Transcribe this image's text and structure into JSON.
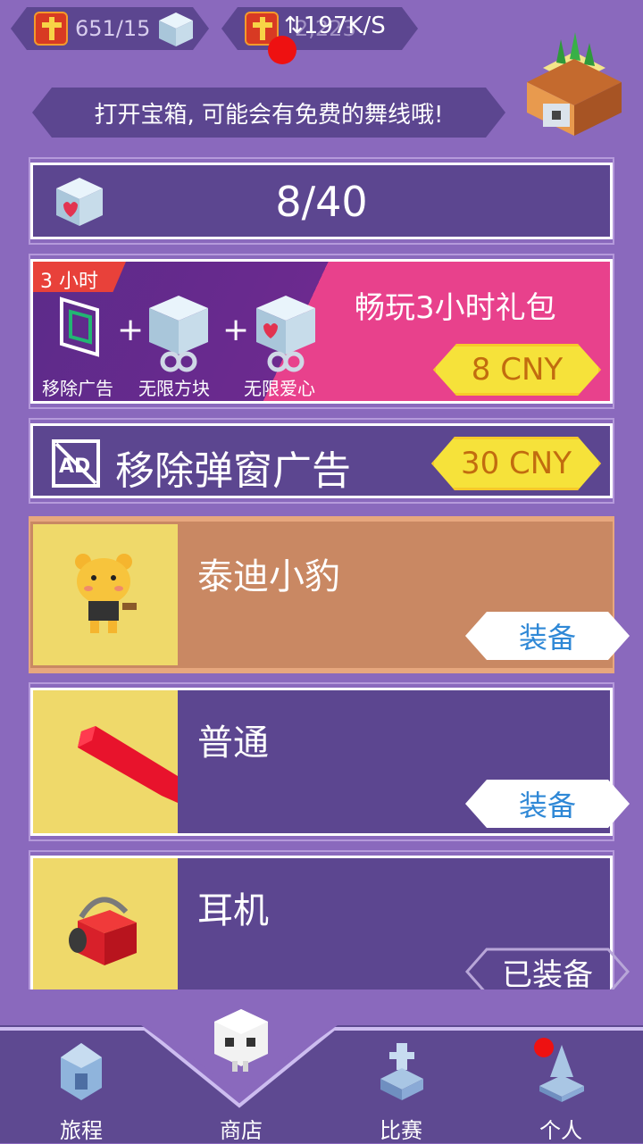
{
  "status_bar": {
    "network_speed": "197K/S"
  },
  "top_bar": {
    "stat_left": "651/15",
    "stat_right": "2,223"
  },
  "hint": {
    "text": "打开宝箱, 可能会有免费的舞线哦!"
  },
  "hearts": {
    "count": "8/40"
  },
  "bundle": {
    "badge": "3 小时",
    "title": "畅玩3小时礼包",
    "price": "8 CNY",
    "items": [
      "移除广告",
      "无限方块",
      "无限爱心"
    ]
  },
  "remove_ads": {
    "label": "移除弹窗广告",
    "price": "30 CNY"
  },
  "skins": [
    {
      "name": "泰迪小豹",
      "action": "装备"
    },
    {
      "name": "普通",
      "action": "装备"
    },
    {
      "name": "耳机",
      "action": "已装备"
    }
  ],
  "nav": {
    "items": [
      {
        "label": "旅程",
        "icon": "house-icon"
      },
      {
        "label": "商店",
        "icon": "skull-icon"
      },
      {
        "label": "比赛",
        "icon": "trophy-icon"
      },
      {
        "label": "个人",
        "icon": "person-icon"
      }
    ]
  },
  "colors": {
    "background": "#8a69bd",
    "panel": "#5c4690",
    "bundle_pink": "#e8418c",
    "selected_card": "#c98863",
    "price_yellow": "#f6e23a",
    "equip_blue": "#2f88d6"
  }
}
